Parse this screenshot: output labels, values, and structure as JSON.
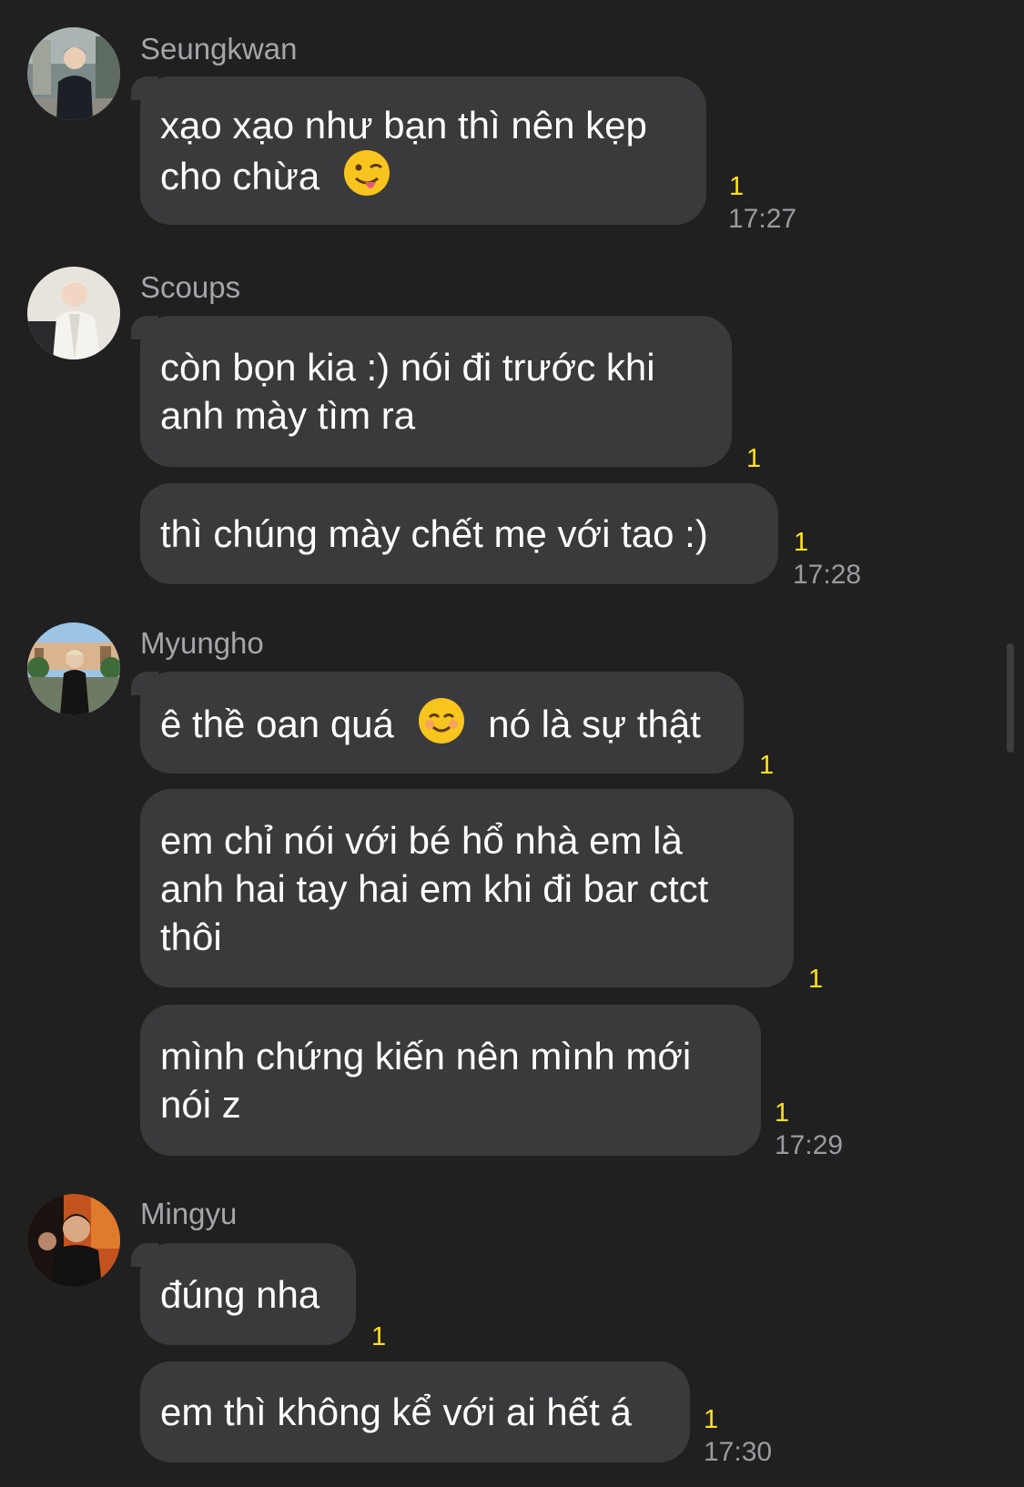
{
  "messages": [
    {
      "sender": "Seungkwan",
      "bubbles": [
        {
          "lines": [
            "xạo xạo như bạn thì nên kẹp",
            "cho chừa"
          ],
          "emoji": "winking-face-tongue-icon",
          "unread": "1",
          "time": "17:27"
        }
      ]
    },
    {
      "sender": "Scoups",
      "bubbles": [
        {
          "lines": [
            "còn bọn kia :) nói đi trước khi",
            "anh mày tìm ra"
          ],
          "unread": "1"
        },
        {
          "lines": [
            "thì chúng mày chết mẹ với tao :)"
          ],
          "unread": "1",
          "time": "17:28"
        }
      ]
    },
    {
      "sender": "Myungho",
      "bubbles": [
        {
          "before_emoji": "ê thề oan quá ",
          "emoji": "smiling-face-icon",
          "after_emoji": " nó là sự thật",
          "unread": "1"
        },
        {
          "lines": [
            "em chỉ nói với bé hổ nhà em là",
            "anh hai tay hai em khi đi bar ctct",
            "thôi"
          ],
          "unread": "1"
        },
        {
          "lines": [
            "mình chứng kiến nên mình mới",
            "nói z"
          ],
          "unread": "1",
          "time": "17:29"
        }
      ]
    },
    {
      "sender": "Mingyu",
      "bubbles": [
        {
          "lines": [
            "đúng nha"
          ],
          "unread": "1"
        },
        {
          "lines": [
            "em thì không kể với ai hết á"
          ],
          "unread": "1",
          "time": "17:30"
        }
      ]
    }
  ],
  "colors": {
    "background": "#202021",
    "bubble": "#3a3a3c",
    "unread": "#ffe21a",
    "meta": "#9a9aa0"
  }
}
